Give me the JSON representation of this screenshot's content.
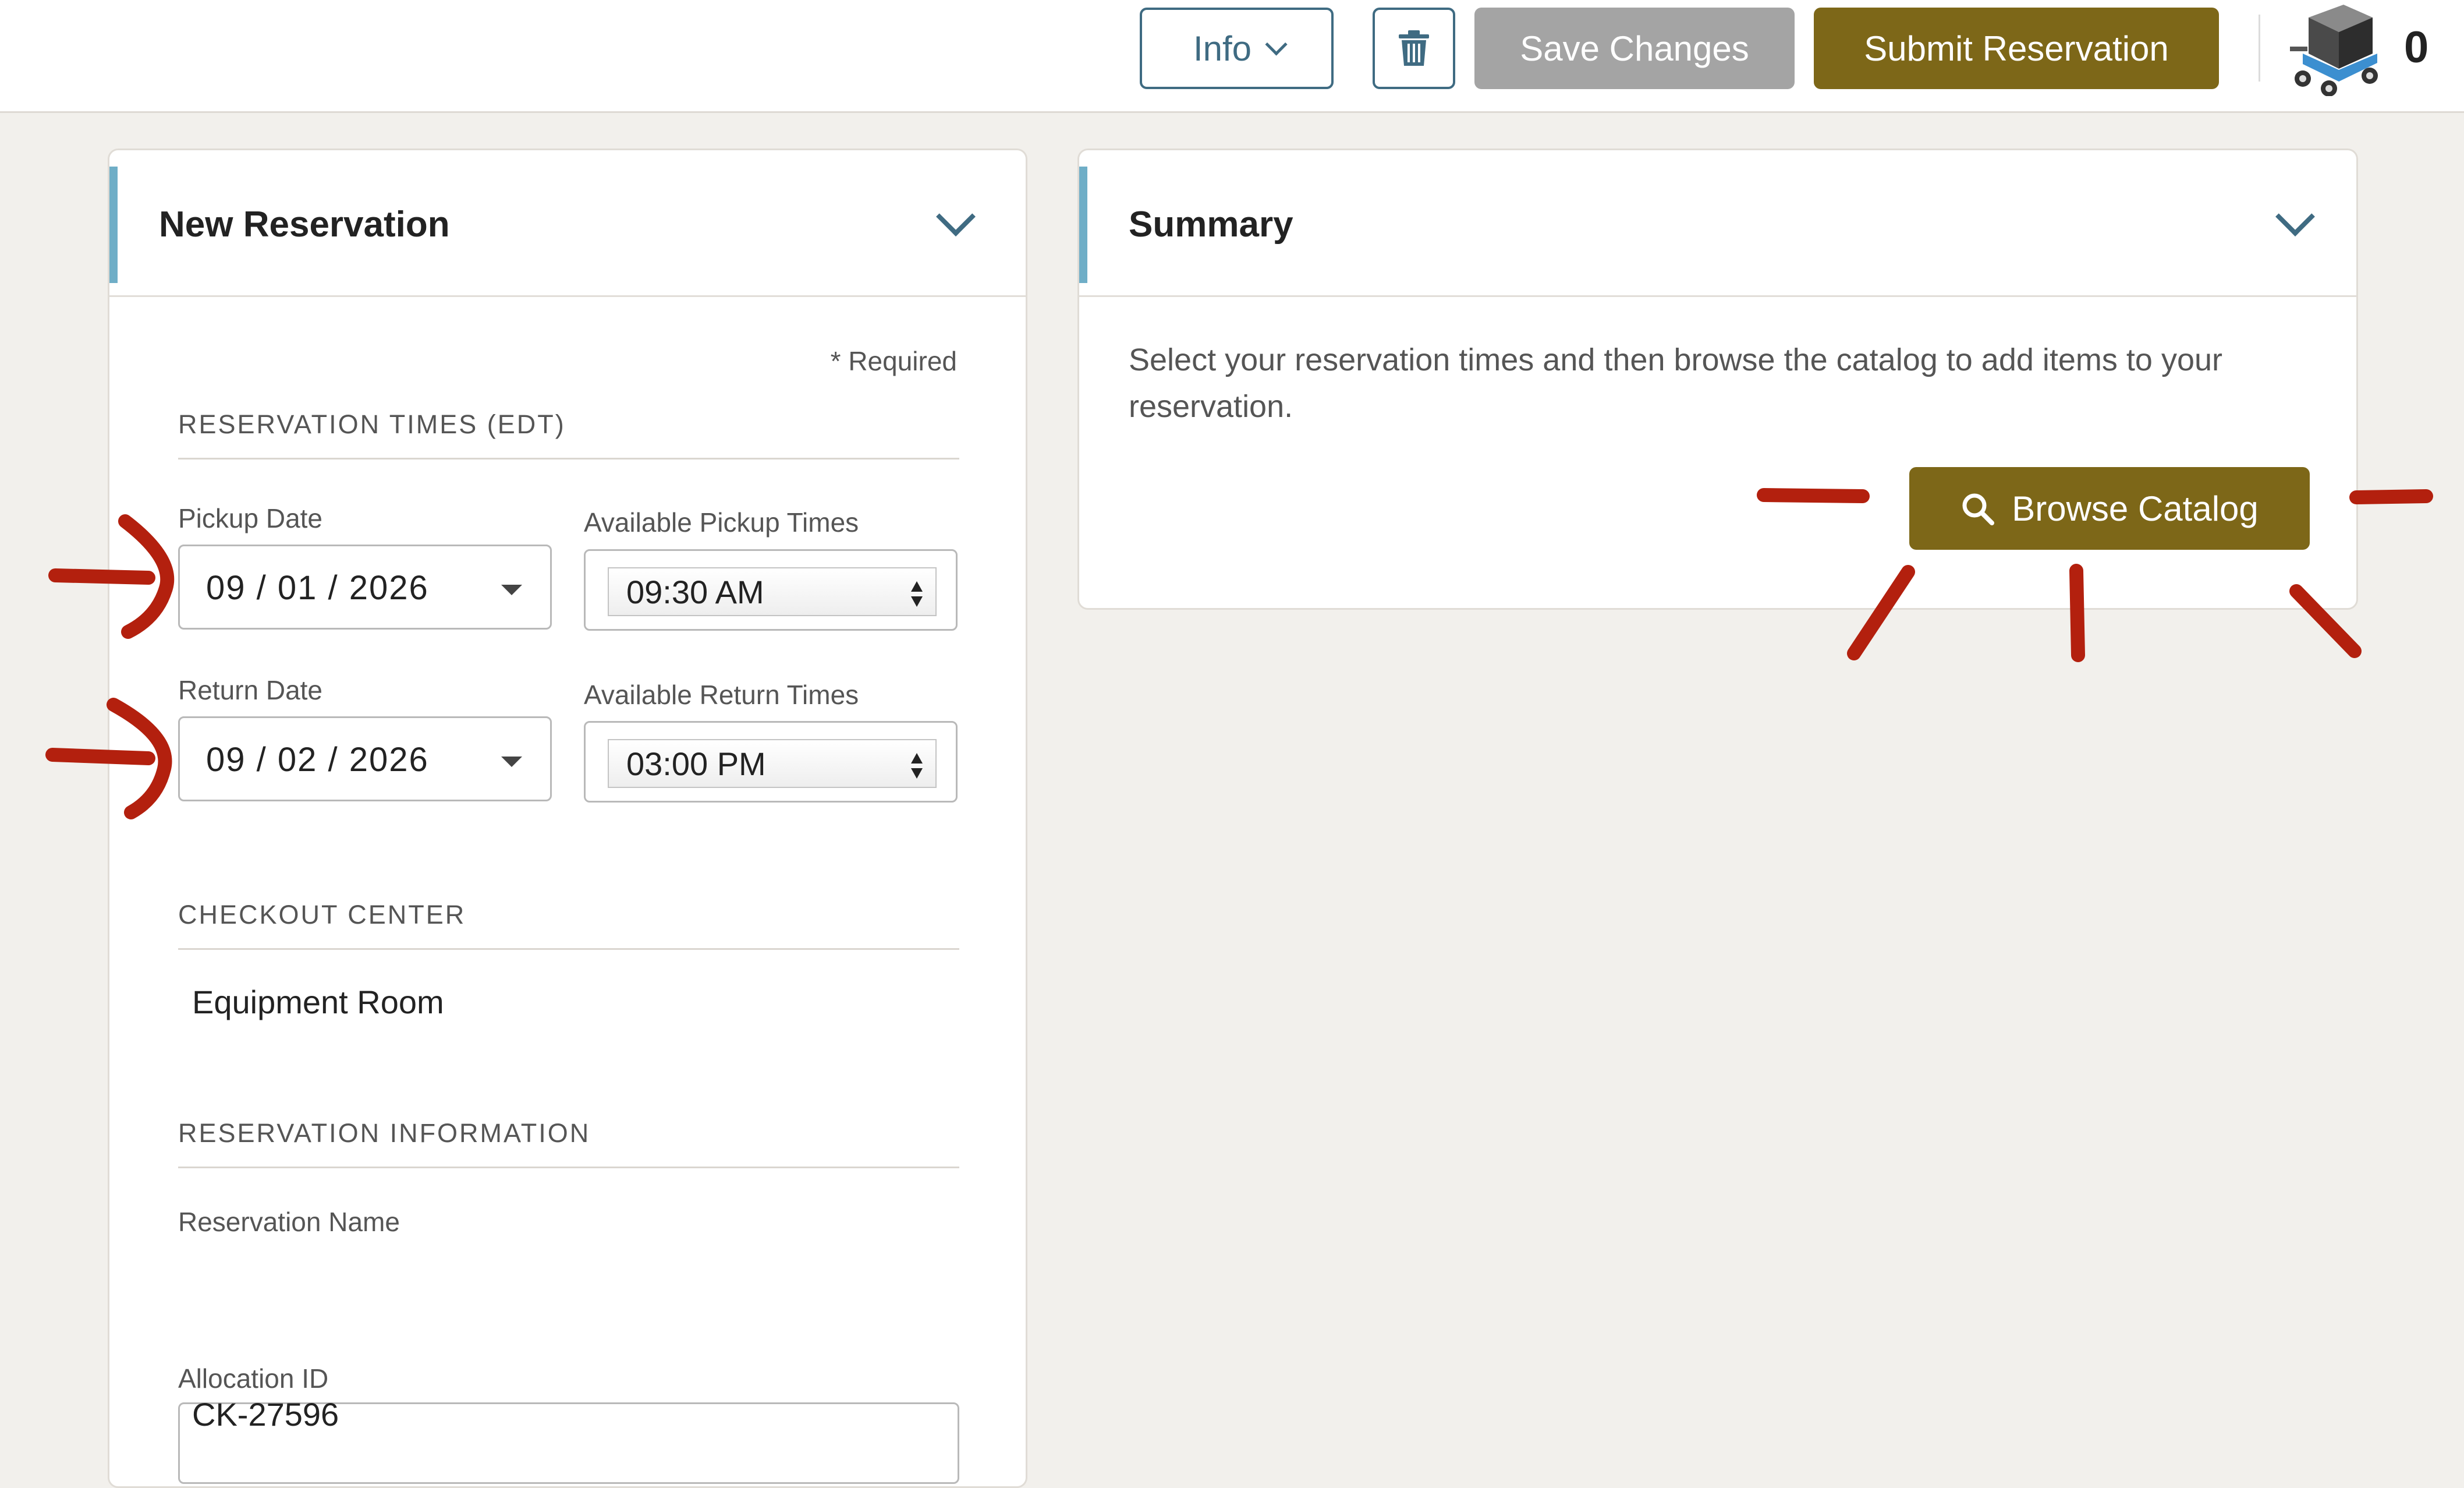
{
  "header": {
    "info_label": "Info",
    "save_label": "Save Changes",
    "submit_label": "Submit Reservation",
    "cart_count": "0"
  },
  "new_reservation": {
    "title": "New Reservation",
    "required_note": "* Required",
    "times_section": "RESERVATION TIMES (EDT)",
    "pickup_date_label": "Pickup Date",
    "pickup_date_value": "09 / 01 / 2026",
    "pickup_times_label": "Available Pickup Times",
    "pickup_time_value": "09:30 AM",
    "return_date_label": "Return Date",
    "return_date_value": "09 / 02 / 2026",
    "return_times_label": "Available Return Times",
    "return_time_value": "03:00 PM",
    "checkout_section": "CHECKOUT CENTER",
    "checkout_value": "Equipment Room",
    "info_section": "RESERVATION INFORMATION",
    "name_label": "Reservation Name",
    "name_value": "",
    "allocation_label": "Allocation ID",
    "allocation_value": "CK-27596"
  },
  "summary": {
    "title": "Summary",
    "text": "Select your reservation times and then browse the catalog to add items to your reservation.",
    "browse_label": "Browse Catalog"
  },
  "colors": {
    "accent_gold": "#7d6718",
    "accent_blue": "#3f6b82",
    "header_accent": "#6faec7",
    "annotation_red": "#b3200e"
  },
  "icons": [
    "chevron-down-icon",
    "trash-icon",
    "cart-icon",
    "search-icon"
  ]
}
